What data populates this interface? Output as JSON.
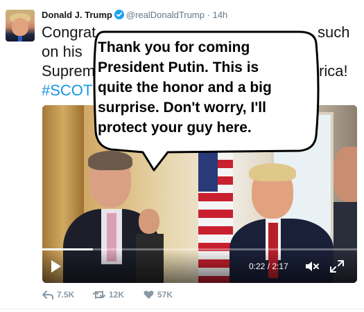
{
  "tweet": {
    "author_name": "Donald J. Trump",
    "handle": "@realDonaldTrump",
    "separator": "·",
    "time": "14h",
    "text_lines": [
      "Congrat",
      "such",
      "on his",
      "Suprem",
      "rica!",
      "#SCOT"
    ],
    "verified_icon": "verified-badge-icon"
  },
  "speech_bubble": {
    "lines": [
      "Thank you for coming",
      "President Putin. This is",
      "quite the honor and a big",
      "surprise. Don't worry, I'll",
      "protect your guy here."
    ]
  },
  "video": {
    "time_label": "0:22 / 2:17",
    "progress": 0.16,
    "icons": [
      "play-icon",
      "mute-icon",
      "fullscreen-icon"
    ]
  },
  "actions": {
    "reply_count": "7.5K",
    "retweet_count": "12K",
    "like_count": "57K"
  },
  "colors": {
    "link": "#1b95e0",
    "verified": "#1da1f2",
    "meta": "#657786",
    "action": "#8899a6"
  }
}
